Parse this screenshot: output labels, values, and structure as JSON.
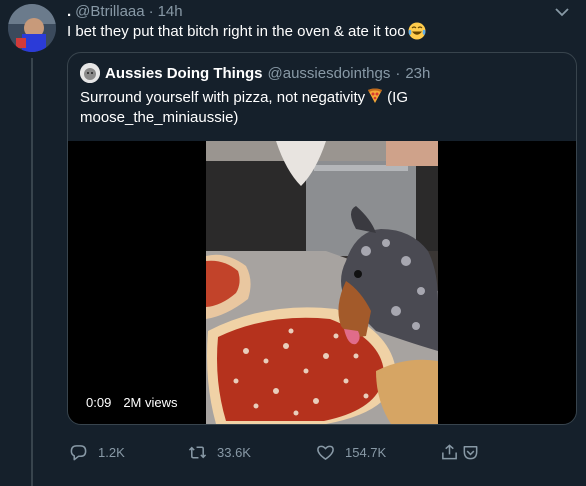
{
  "tweet": {
    "name": ".",
    "handle": "@Btrillaaa",
    "separator": "·",
    "time": "14h",
    "text": "I bet they put that bitch right in the oven & ate it too",
    "emoji": "crying-laughing-emoji"
  },
  "quote": {
    "name": "Aussies Doing Things",
    "handle": "@aussiesdointhgs",
    "separator": "·",
    "time": "23h",
    "text_before": "Surround yourself with pizza, not negativity",
    "emoji": "pizza-emoji",
    "text_after": "(IG moose_the_miniaussie)",
    "video": {
      "duration": "0:09",
      "views": "2M views"
    }
  },
  "actions": {
    "reply_count": "1.2K",
    "retweet_count": "33.6K",
    "like_count": "154.7K"
  },
  "colors": {
    "background": "#15202b",
    "secondary_text": "#8899a6",
    "border": "#38444d"
  }
}
